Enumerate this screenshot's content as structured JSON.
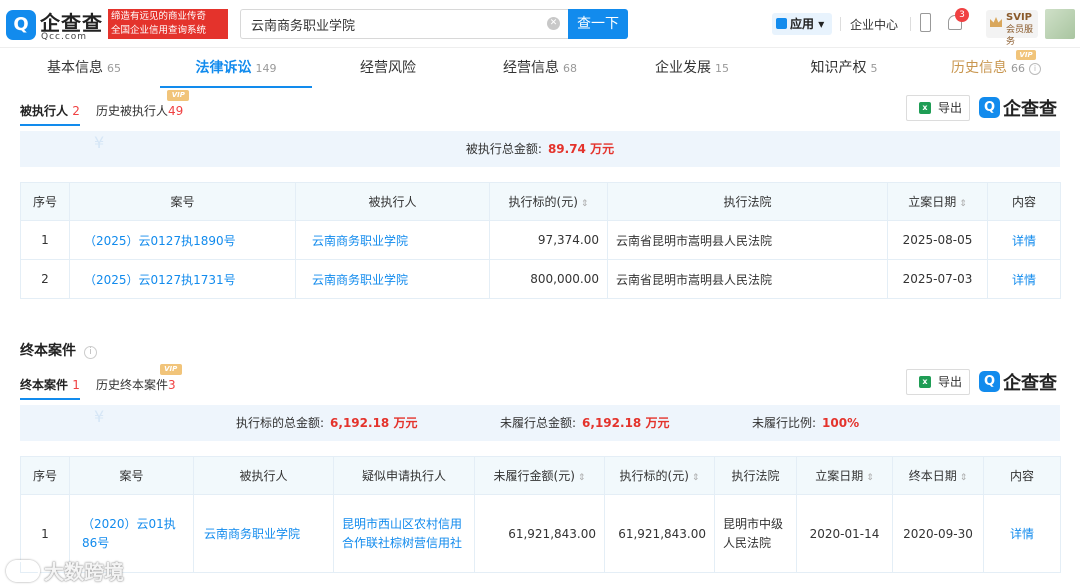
{
  "header": {
    "logo_mark": "Q",
    "logo_name": "企查查",
    "logo_sub": "Qcc.com",
    "slogan_line1": "缔造有远见的商业传奇",
    "slogan_line2": "全国企业信用查询系统",
    "search_value": "云南商务职业学院",
    "search_button": "查一下",
    "apps_label": "应用",
    "center_label": "企业中心",
    "notif_count": "3",
    "svip_label": "SVIP",
    "svip_sub": "会员服务"
  },
  "tabs": [
    {
      "label": "基本信息",
      "count": "65"
    },
    {
      "label": "法律诉讼",
      "count": "149"
    },
    {
      "label": "经营风险",
      "count": ""
    },
    {
      "label": "经营信息",
      "count": "68"
    },
    {
      "label": "企业发展",
      "count": "15"
    },
    {
      "label": "知识产权",
      "count": "5"
    },
    {
      "label": "历史信息",
      "count": "66",
      "vip": "VIP"
    }
  ],
  "section1": {
    "subtab_active": "被执行人",
    "subtab_active_count": "2",
    "subtab_history": "历史被执行人",
    "subtab_history_count": "49",
    "vip": "VIP",
    "export_label": "导出",
    "brand": "企查查",
    "summary_label": "被执行总金额:",
    "summary_value": "89.74 万元",
    "columns": [
      "序号",
      "案号",
      "被执行人",
      "执行标的(元)",
      "执行法院",
      "立案日期",
      "内容"
    ],
    "rows": [
      {
        "no": "1",
        "case": "（2025）云0127执1890号",
        "party": "云南商务职业学院",
        "amount": "97,374.00",
        "court": "云南省昆明市嵩明县人民法院",
        "date": "2025-08-05",
        "action": "详情"
      },
      {
        "no": "2",
        "case": "（2025）云0127执1731号",
        "party": "云南商务职业学院",
        "amount": "800,000.00",
        "court": "云南省昆明市嵩明县人民法院",
        "date": "2025-07-03",
        "action": "详情"
      }
    ]
  },
  "section2": {
    "title": "终本案件",
    "subtab_active": "终本案件",
    "subtab_active_count": "1",
    "subtab_history": "历史终本案件",
    "subtab_history_count": "3",
    "vip": "VIP",
    "export_label": "导出",
    "brand": "企查查",
    "sum1_label": "执行标的总金额:",
    "sum1_value": "6,192.18 万元",
    "sum2_label": "未履行总金额:",
    "sum2_value": "6,192.18 万元",
    "sum3_label": "未履行比例:",
    "sum3_value": "100%",
    "columns": [
      "序号",
      "案号",
      "被执行人",
      "疑似申请执行人",
      "未履行金额(元)",
      "执行标的(元)",
      "执行法院",
      "立案日期",
      "终本日期",
      "内容"
    ],
    "rows": [
      {
        "no": "1",
        "case": "（2020）云01执86号",
        "party": "云南商务职业学院",
        "applicant": "昆明市西山区农村信用合作联社棕树营信用社",
        "unpaid": "61,921,843.00",
        "amount": "61,921,843.00",
        "court": "昆明市中级人民法院",
        "date": "2020-01-14",
        "end_date": "2020-09-30",
        "action": "详情"
      }
    ]
  },
  "watermark": "大数跨境",
  "colors": {
    "accent": "#128bed",
    "alert": "#e4332c",
    "vip": "#f1c47a",
    "header_bg": "#f2f9fc"
  }
}
